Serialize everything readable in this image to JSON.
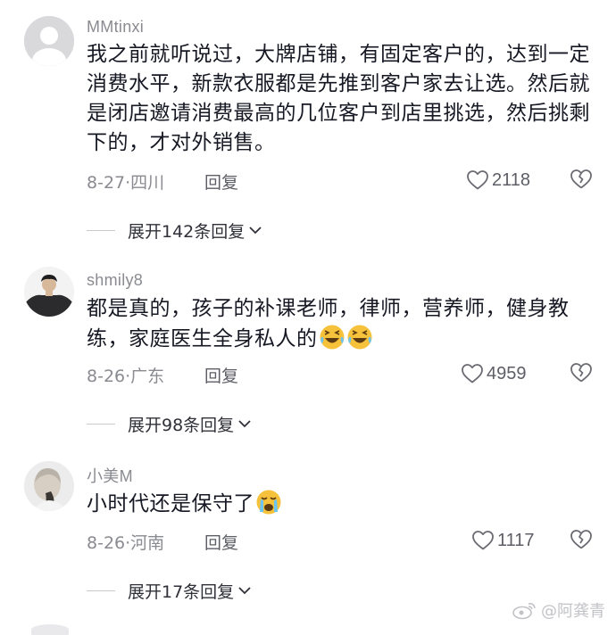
{
  "comments": [
    {
      "username": "MMtinxi",
      "text": "我之前就听说过，大牌店铺，有固定客户的，达到一定消费水平，新款衣服都是先推到客户家去让选。然后就是闭店邀请消费最高的几位客户到店里挑选，然后挑剩下的，才对外销售。",
      "date": "8-27",
      "location": "四川",
      "reply_label": "回复",
      "likes": "2118",
      "expand_label": "展开142条回复"
    },
    {
      "username": "shmily8",
      "text": "都是真的，孩子的补课老师，律师，营养师，健身教练，家庭医生全身私人的",
      "date": "8-26",
      "location": "广东",
      "reply_label": "回复",
      "likes": "4959",
      "expand_label": "展开98条回复"
    },
    {
      "username": "小美M",
      "text": "小时代还是保守了",
      "date": "8-26",
      "location": "河南",
      "reply_label": "回复",
      "likes": "1117",
      "expand_label": "展开17条回复"
    }
  ],
  "watermark": "@阿龚青",
  "colors": {
    "text": "#161823",
    "secondary": "#8a8b91",
    "emoji_face": "#f7c23b"
  }
}
